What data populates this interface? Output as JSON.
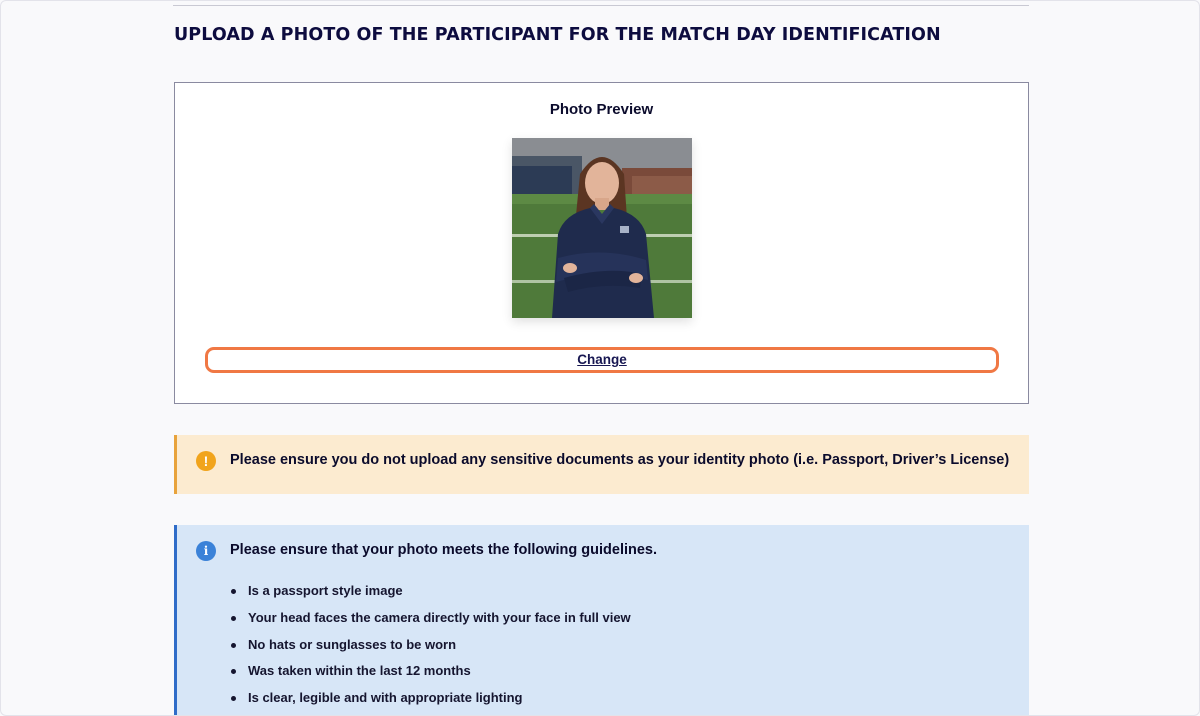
{
  "section": {
    "title": "UPLOAD A PHOTO OF THE PARTICIPANT FOR THE MATCH DAY IDENTIFICATION"
  },
  "preview": {
    "title": "Photo Preview",
    "change_label": "Change"
  },
  "warning": {
    "icon": "exclamation-icon",
    "text": "Please ensure you do not upload any sensitive documents as your identity photo (i.e. Passport, Driver’s License)",
    "accent": "#e8a33c",
    "background": "#fcebd0"
  },
  "info": {
    "icon": "info-icon",
    "title": "Please ensure that your photo meets the following guidelines.",
    "guidelines": [
      "Is a passport style image",
      "Your head faces the camera directly with your face in full view",
      "No hats or sunglasses to be worn",
      "Was taken within the last 12 months",
      "Is clear, legible and with appropriate lighting"
    ],
    "accent": "#2f6cc8",
    "background": "#d7e6f7"
  },
  "colors": {
    "title": "#0d0c3f",
    "focus_ring": "#f07844"
  }
}
